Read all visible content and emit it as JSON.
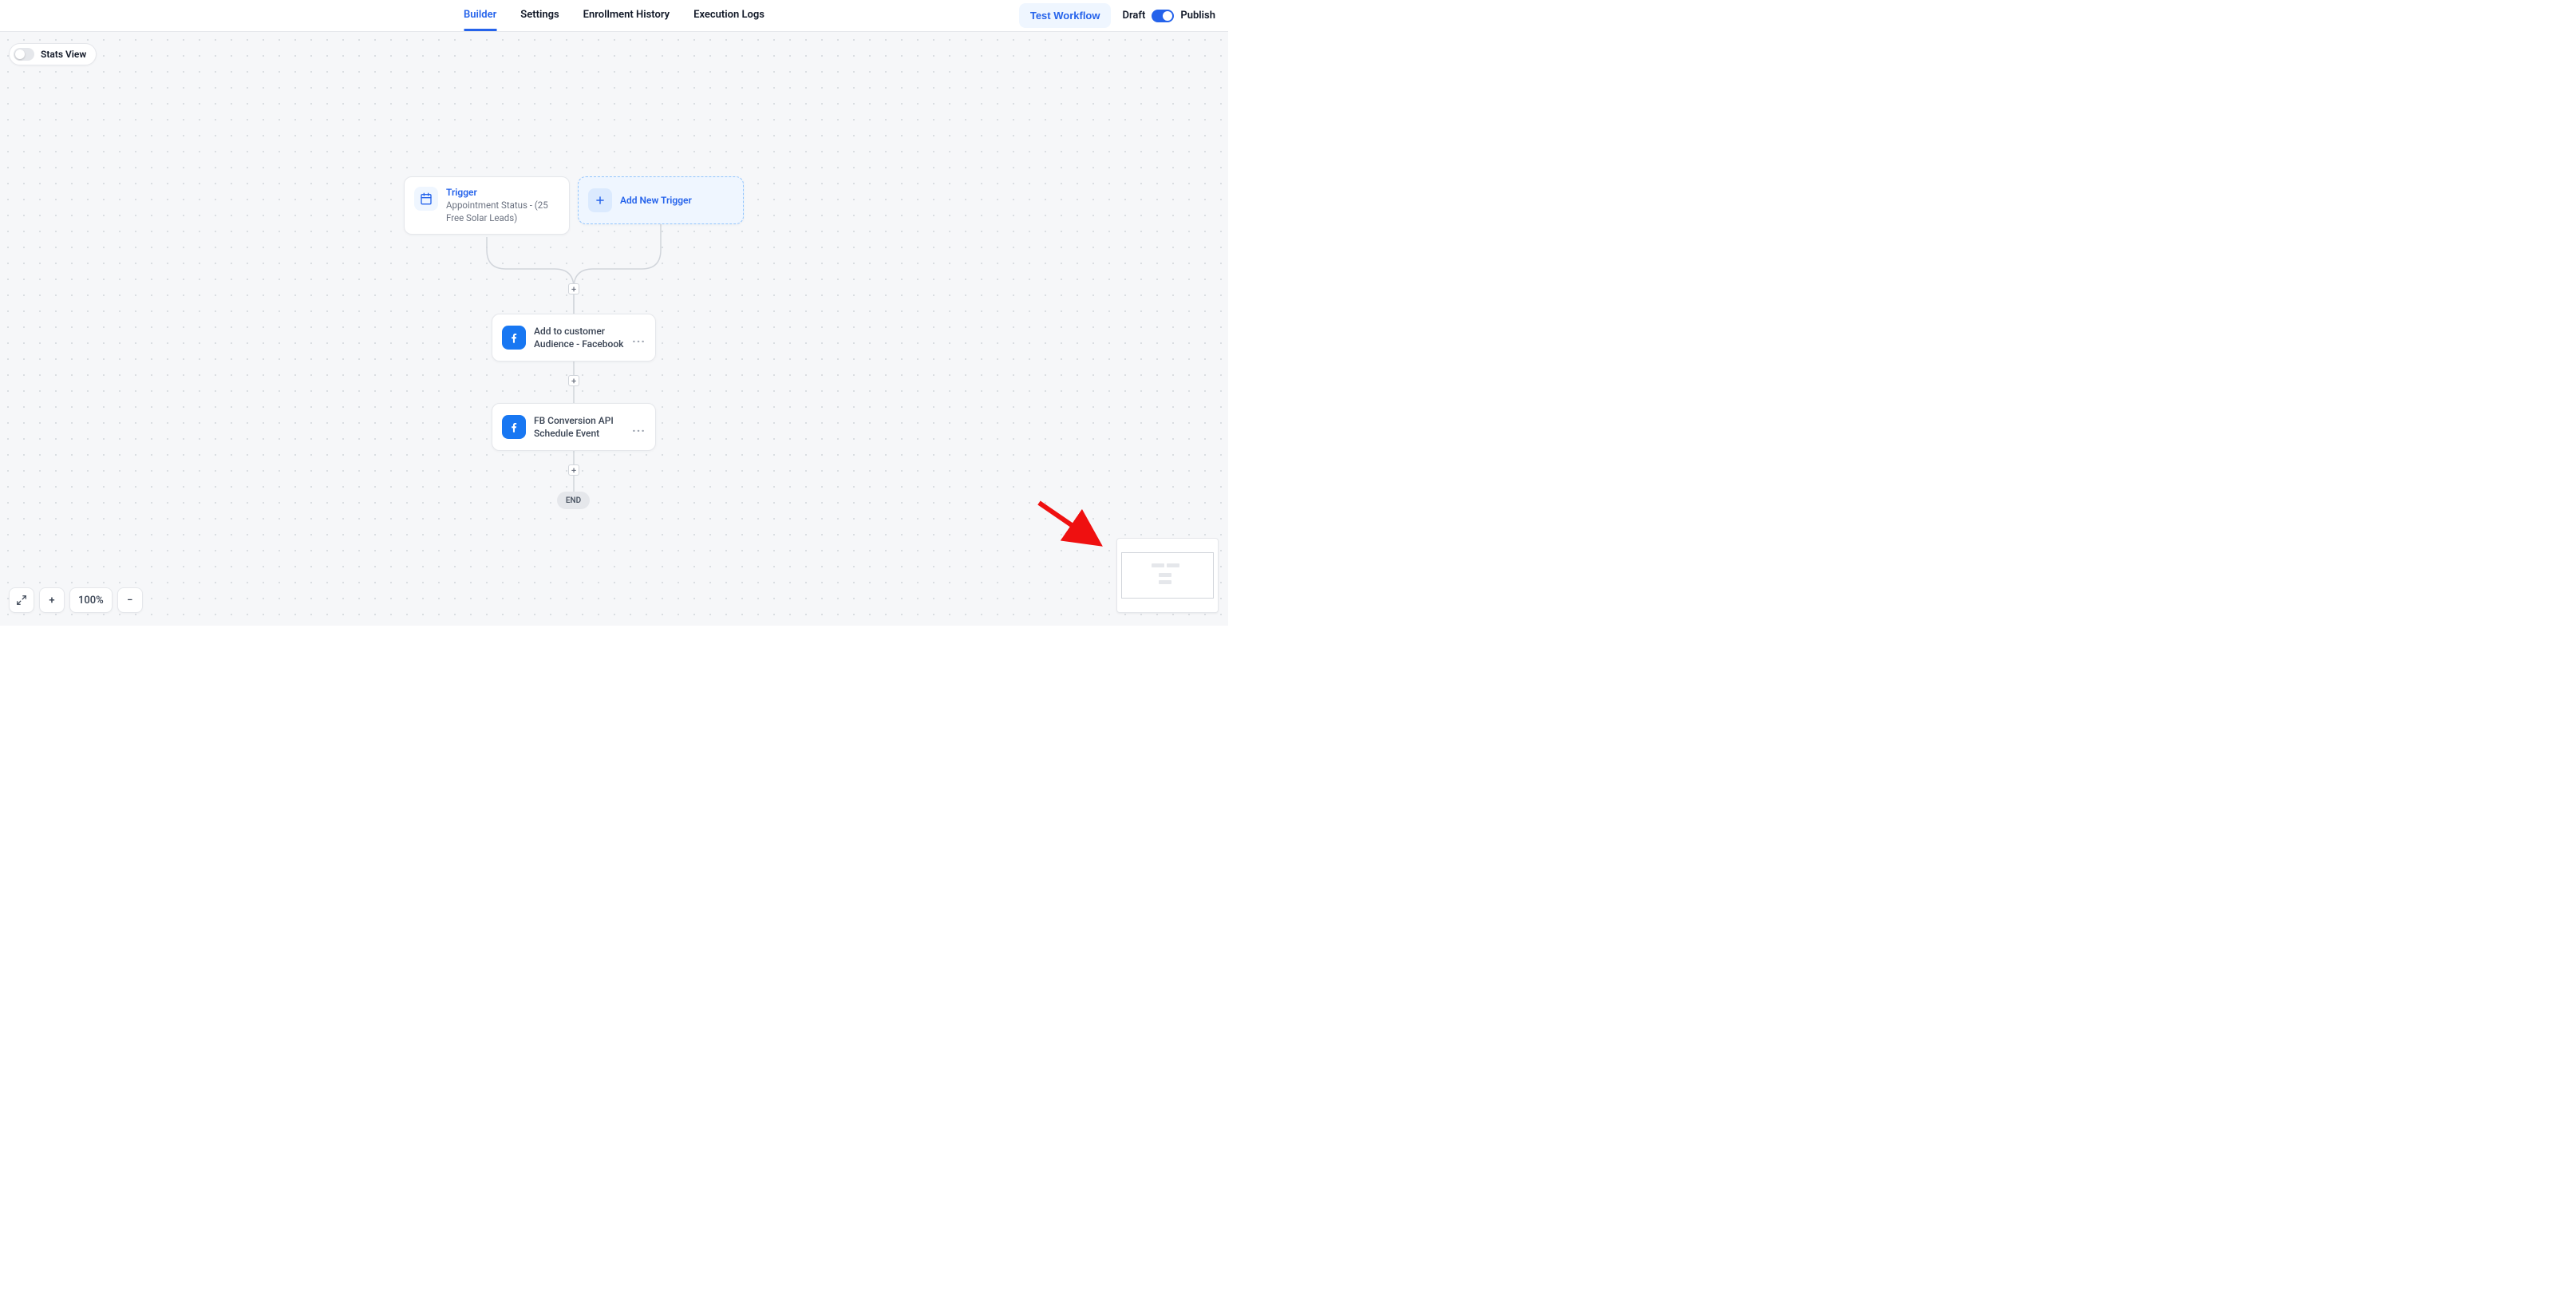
{
  "tabs": {
    "builder": "Builder",
    "settings": "Settings",
    "enrollment": "Enrollment History",
    "execution": "Execution Logs"
  },
  "topbar": {
    "test": "Test Workflow",
    "draft": "Draft",
    "publish": "Publish"
  },
  "stats_view_label": "Stats View",
  "trigger": {
    "title": "Trigger",
    "subtitle": "Appointment Status - (25 Free Solar Leads)"
  },
  "add_trigger_label": "Add New Trigger",
  "action1_label": "Add to customer Audience - Facebook",
  "action2_label": "FB Conversion API Schedule Event",
  "end_label": "END",
  "zoom_level": "100%",
  "icons": {
    "plus": "+",
    "minus": "−",
    "more": "..."
  }
}
